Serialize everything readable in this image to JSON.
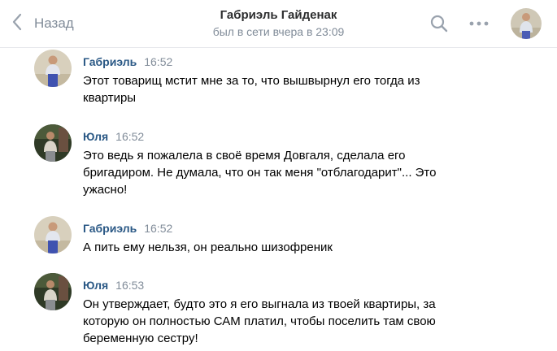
{
  "header": {
    "back_label": "Назад",
    "title": "Габриэль Гайденак",
    "subtitle": "был в сети вчера в 23:09",
    "icons": [
      "chevron-left-icon",
      "search-icon",
      "more-horizontal-icon"
    ]
  },
  "messages": [
    {
      "author": "Габриэль",
      "time": "16:52",
      "text": "Этот товарищ мстит мне за то, что вышвырнул его тогда из квартиры"
    },
    {
      "author": "Юля",
      "time": "16:52",
      "text": "Это ведь я пожалела в своё время Довгаля, сделала его бригадиром. Не думала, что он так меня \"отблагодарит\"... Это ужасно!"
    },
    {
      "author": "Габриэль",
      "time": "16:52",
      "text": "А пить ему нельзя, он реально шизофреник"
    },
    {
      "author": "Юля",
      "time": "16:53",
      "text": "Он утверждает, будто это я его выгнала из твоей квартиры, за которую он полностью САМ платил, чтобы поселить там свою беременную сестру!"
    }
  ],
  "colors": {
    "author": "#2a5885",
    "muted": "#818c99",
    "divider": "#e7e8ec"
  }
}
